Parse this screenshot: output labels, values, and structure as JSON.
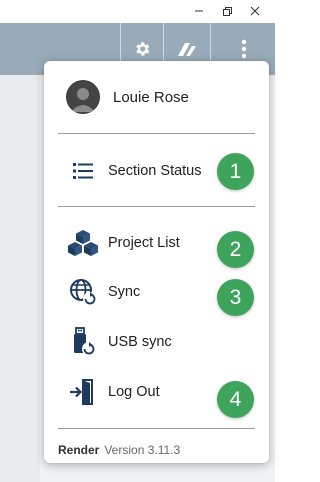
{
  "user": {
    "name": "Louie Rose"
  },
  "menu": {
    "items": [
      {
        "label": "Section Status",
        "icon": "list-icon"
      },
      {
        "label": "Project List",
        "icon": "cubes-icon"
      },
      {
        "label": "Sync",
        "icon": "globe-sync-icon"
      },
      {
        "label": "USB sync",
        "icon": "usb-sync-icon"
      },
      {
        "label": "Log Out",
        "icon": "logout-icon"
      }
    ],
    "badges": [
      "1",
      "2",
      "3",
      "4"
    ]
  },
  "footer": {
    "brand": "Render",
    "version": "Version 3.11.3"
  },
  "toolbar": {
    "icons": [
      "gear-icon",
      "logo-icon",
      "more-vertical-icon"
    ]
  },
  "colors": {
    "toolbar": "#99abb8",
    "badge": "#3fa45b",
    "icon": "#1f3a5f"
  }
}
